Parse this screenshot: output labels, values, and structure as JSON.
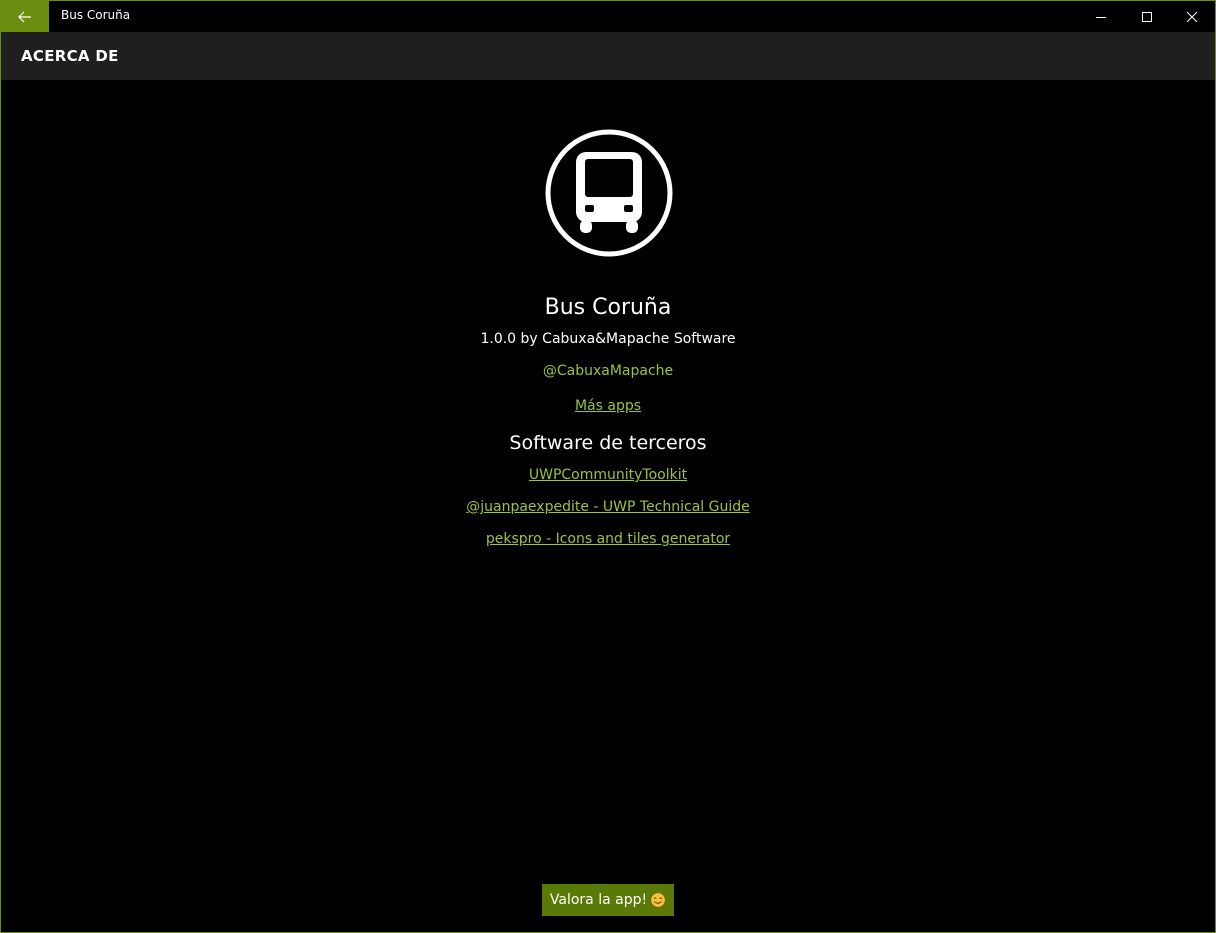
{
  "window": {
    "title": "Bus Coruña",
    "accent_color": "#6b8e10",
    "back_icon": "arrow-left-icon",
    "minimize_icon": "minimize-icon",
    "maximize_icon": "maximize-icon",
    "close_icon": "close-icon"
  },
  "header": {
    "title": "ACERCA DE"
  },
  "about": {
    "logo_icon": "bus-icon",
    "app_name": "Bus Coruña",
    "version_line": "1.0.0 by Cabuxa&Mapache Software",
    "twitter": "@CabuxaMapache",
    "more_apps": "Más apps",
    "link_color": "#9cc33a"
  },
  "third_party": {
    "title": "Software de terceros",
    "items": [
      {
        "label": "UWPCommunityToolkit"
      },
      {
        "label": "@juanpaexpedite - UWP Technical Guide"
      },
      {
        "label": "pekspro - Icons and tiles generator"
      }
    ]
  },
  "rate": {
    "label": "Valora la app!",
    "icon": "smiley-icon",
    "color": "#5a7a08"
  }
}
